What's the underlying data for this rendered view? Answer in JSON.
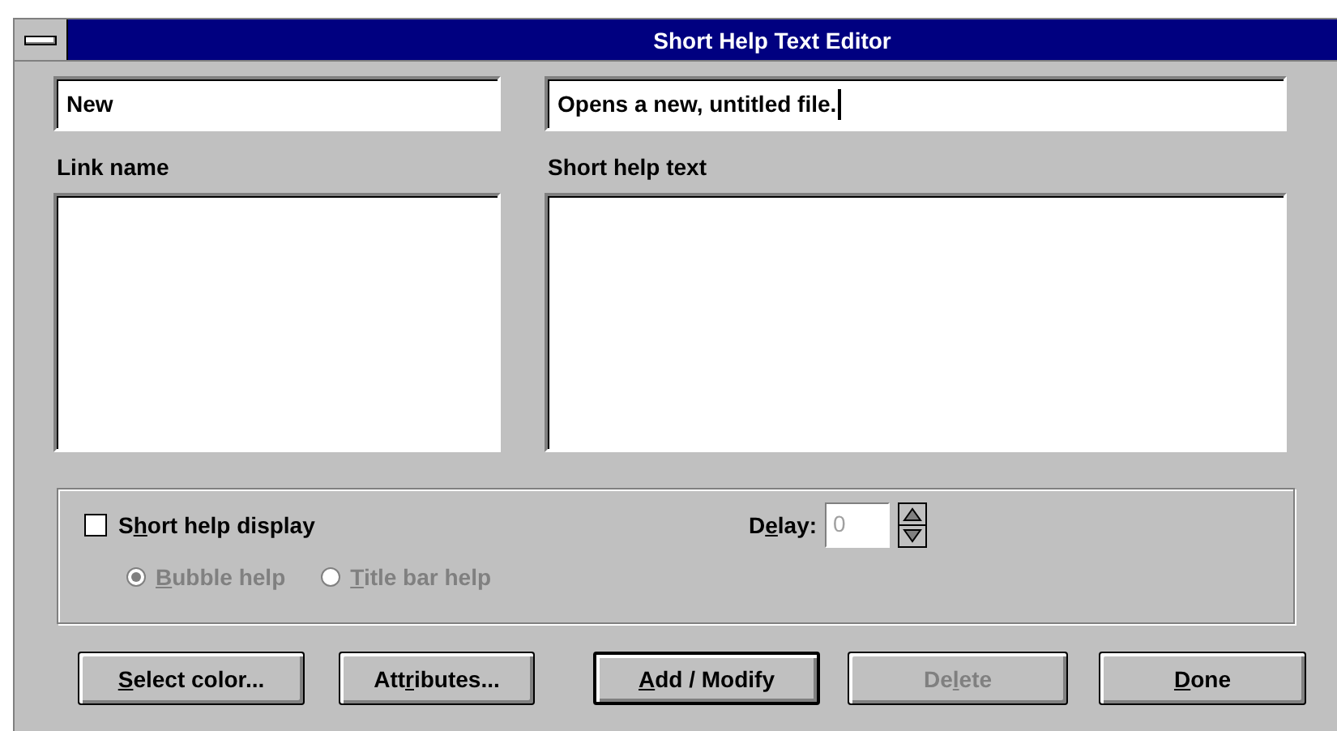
{
  "window": {
    "title": "Short Help Text Editor"
  },
  "link_field": {
    "value": "New"
  },
  "help_field": {
    "value": "Opens a new, untitled file.",
    "focused": true
  },
  "link_list": {
    "label": "Link name"
  },
  "help_list": {
    "label": "Short help text"
  },
  "display_checkbox": {
    "label": {
      "before": "S",
      "key": "h",
      "after": "ort help display"
    },
    "checked": false
  },
  "delay": {
    "label": {
      "before": "D",
      "key": "e",
      "after": "lay:"
    },
    "value": "0",
    "disabled": true
  },
  "radios": [
    {
      "label": {
        "key": "B",
        "after": "ubble help"
      },
      "selected": true,
      "disabled": true
    },
    {
      "label": {
        "key": "T",
        "after": "itle bar help"
      },
      "selected": false,
      "disabled": true
    }
  ],
  "buttons": [
    {
      "label": {
        "key": "S",
        "after": "elect color..."
      },
      "disabled": false,
      "default": false
    },
    {
      "label": {
        "before": "Att",
        "key": "r",
        "after": "ibutes..."
      },
      "disabled": false,
      "default": false
    },
    {
      "label": {
        "key": "A",
        "after": "dd / Modify"
      },
      "disabled": false,
      "default": true
    },
    {
      "label": {
        "before": "De",
        "key": "l",
        "after": "ete"
      },
      "disabled": true,
      "default": false
    },
    {
      "label": {
        "key": "D",
        "after": "one"
      },
      "disabled": false,
      "default": false
    }
  ]
}
